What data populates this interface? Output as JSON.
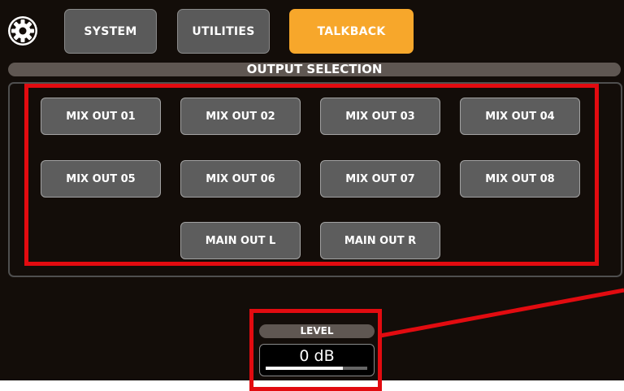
{
  "tabs": [
    {
      "label": "SYSTEM",
      "active": false
    },
    {
      "label": "UTILITIES",
      "active": false
    },
    {
      "label": "TALKBACK",
      "active": true
    }
  ],
  "section_title": "OUTPUT SELECTION",
  "outputs": [
    "MIX OUT 01",
    "MIX OUT 02",
    "MIX OUT 03",
    "MIX OUT 04",
    "MIX OUT 05",
    "MIX OUT 06",
    "MIX OUT 07",
    "MIX OUT 08",
    "MAIN OUT L",
    "MAIN OUT R"
  ],
  "level": {
    "label": "LEVEL",
    "value": "0 dB",
    "fader_fraction": 0.76
  },
  "icons": {
    "settings": "gear-icon"
  },
  "colors": {
    "accent": "#f7a72b",
    "highlight": "#e20b10",
    "background": "#130d09",
    "button": "#5d5d5d"
  }
}
